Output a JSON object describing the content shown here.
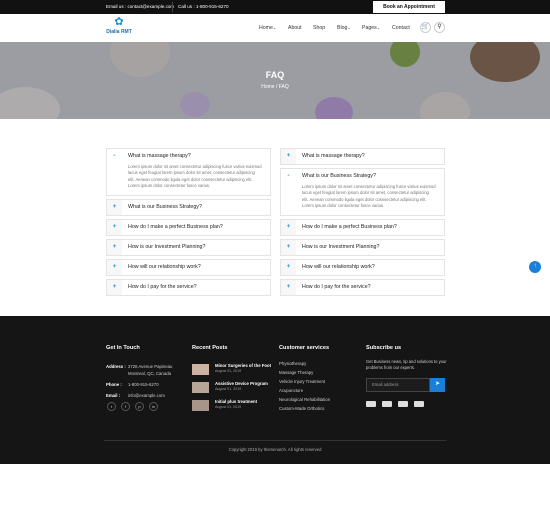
{
  "topbar": {
    "email_label": "Email us : ",
    "email_value": "contact@example.com",
    "call_label": "Call us : ",
    "call_value": "1-800-915-6270",
    "book_button": "Book an Appointment"
  },
  "logo": {
    "name": "Dialia RMT"
  },
  "nav": {
    "home": "Home",
    "about": "About",
    "shop": "Shop",
    "blog": "Blog",
    "pages": "Pages",
    "contact": "Contact"
  },
  "hero": {
    "title": "FAQ",
    "breadcrumb_home": "Home",
    "breadcrumb_sep": "/",
    "breadcrumb_current": "FAQ"
  },
  "faq_left": [
    {
      "q": "What is massage therapy?",
      "open": true,
      "a": "Lorem ipsum dolor sit amet consectetur adipiscing fusce varius euismod lacus eget feugiat lorem ipsum dolor sit amet, consectetur adipiscing elit. Aenean commodo ligula eget dolor cosnsectetur adipiscing elit. Lorem ipsum dolor consectetur fusce varius."
    },
    {
      "q": "What is our Business Strategy?",
      "open": false
    },
    {
      "q": "How do I make a perfect Business plan?",
      "open": false
    },
    {
      "q": "How is our Investment Planning?",
      "open": false
    },
    {
      "q": "How will our relationship work?",
      "open": false
    },
    {
      "q": "How do I pay for the service?",
      "open": false
    }
  ],
  "faq_right": [
    {
      "q": "What is massage therapy?",
      "open": false
    },
    {
      "q": "What is our Business Strategy?",
      "open": true,
      "a": "Lorem ipsum dolor sit amet consectetur adipiscing fusce varius euismod lacus eget feugiat lorem ipsum dolor sit amet, consectetur adipiscing elit. Aenean commodo ligula eget dolor cosnsectetur adipiscing elit. Lorem ipsum dolor consectetur fusce varius."
    },
    {
      "q": "How do I make a perfect Business plan?",
      "open": false
    },
    {
      "q": "How is our Investment Planning?",
      "open": false
    },
    {
      "q": "How will our relationship work?",
      "open": false
    },
    {
      "q": "How do I pay for the service?",
      "open": false
    }
  ],
  "footer": {
    "get_in_touch": {
      "heading": "Get In Touch",
      "address_label": "Address :",
      "address_line1": "2726 Avenue Papineau",
      "address_line2": "Montreal, QC, Canada",
      "phone_label": "Phone :",
      "phone_value": "1-800-915-6270",
      "email_label": "Email :",
      "email_value": "info@example.com",
      "social": [
        "t",
        "f",
        "p",
        "in"
      ]
    },
    "recent_posts": {
      "heading": "Recent Posts",
      "posts": [
        {
          "title": "Minor Surgeries of the Foot",
          "date": "August 01, 2019"
        },
        {
          "title": "Assistive Device Program",
          "date": "August 01, 2019"
        },
        {
          "title": "Initial plus treatment",
          "date": "August 01, 2019"
        }
      ]
    },
    "services": {
      "heading": "Customer services",
      "items": [
        "Physiotherapy",
        "Massage Therapy",
        "Vehicle Injury Treatment",
        "Acupuncture",
        "Neurological Rehabilitation",
        "Custom-Made Orthotics"
      ]
    },
    "subscribe": {
      "heading": "Subscribe us",
      "text": "Get Business news, tip and solutions to your problems from our experts.",
      "placeholder": "Email address",
      "send_icon": "arrow-right-icon"
    },
    "copyright": "Copyright 2019 by themenarch. All rights reserved"
  },
  "colors": {
    "accent": "#1a7fd6",
    "footer_bg": "#151515",
    "topbar_bg": "#111111"
  }
}
